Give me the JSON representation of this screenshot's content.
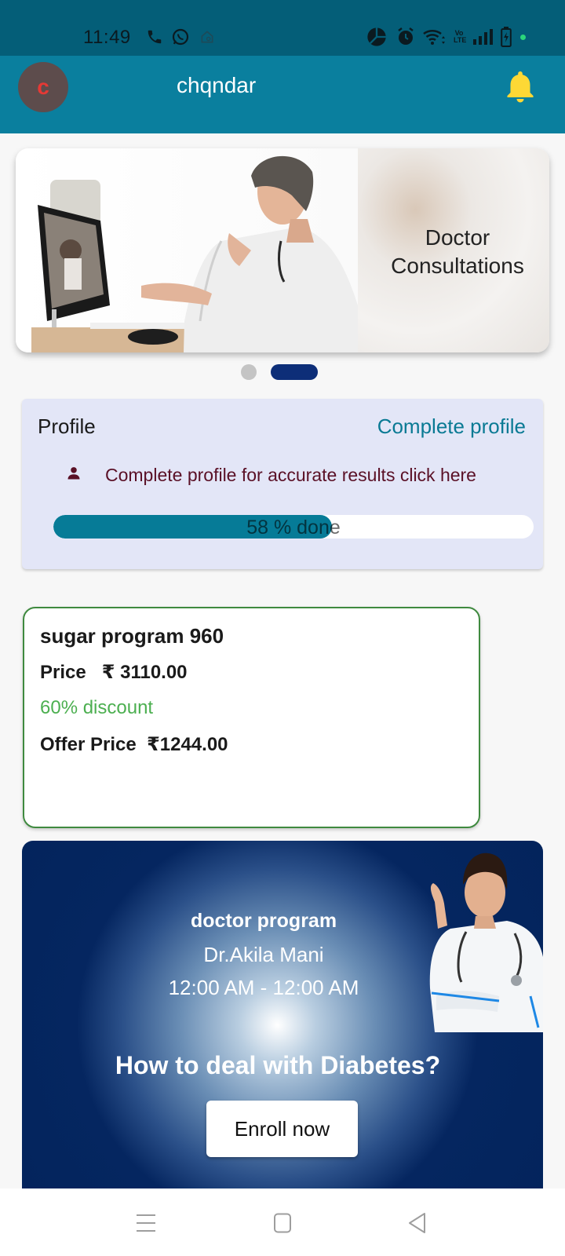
{
  "status_bar": {
    "time": "11:49",
    "left_icons": [
      "phone-icon",
      "whatsapp-icon",
      "home-shield-icon"
    ],
    "right_icons": [
      "data-saver-icon",
      "alarm-icon",
      "wifi-icon",
      "volte-icon",
      "signal-icon",
      "battery-icon",
      "notification-dot-icon"
    ],
    "volte_label": "Vo LTE"
  },
  "app_bar": {
    "avatar_letter": "c",
    "title": "chqndar",
    "notification_icon": "bell-icon",
    "bell_color": "#fdd835"
  },
  "carousel": {
    "slide_text_line1": "Doctor",
    "slide_text_line2": "Consultations",
    "slide_count": 2,
    "active_index": 1
  },
  "profile": {
    "title": "Profile",
    "link_label": "Complete profile",
    "hint_icon": "person-icon",
    "hint_text": "Complete profile for accurate results click here",
    "progress_percent": 58,
    "progress_label": "58 % done"
  },
  "program_card": {
    "title": "sugar program 960",
    "price_label": "Price",
    "price_value": "₹ 3110.00",
    "discount": "60% discount",
    "offer_label": "Offer Price",
    "offer_value": "₹1244.00"
  },
  "doctor_program": {
    "program": "doctor program",
    "doctor_name": "Dr.Akila Mani",
    "time_range": "12:00 AM - 12:00 AM",
    "headline": "How to deal with Diabetes?",
    "enroll_label": "Enroll now"
  },
  "nav_bar": {
    "buttons": [
      "menu-icon",
      "home-icon",
      "back-icon"
    ]
  },
  "colors": {
    "status_bar": "#045e78",
    "app_bar": "#0a7f9e",
    "accent": "#067b97",
    "discount_green": "#4caf50",
    "doctor_card_navy": "#03245c",
    "carousel_active_dot": "#0d2e78"
  }
}
